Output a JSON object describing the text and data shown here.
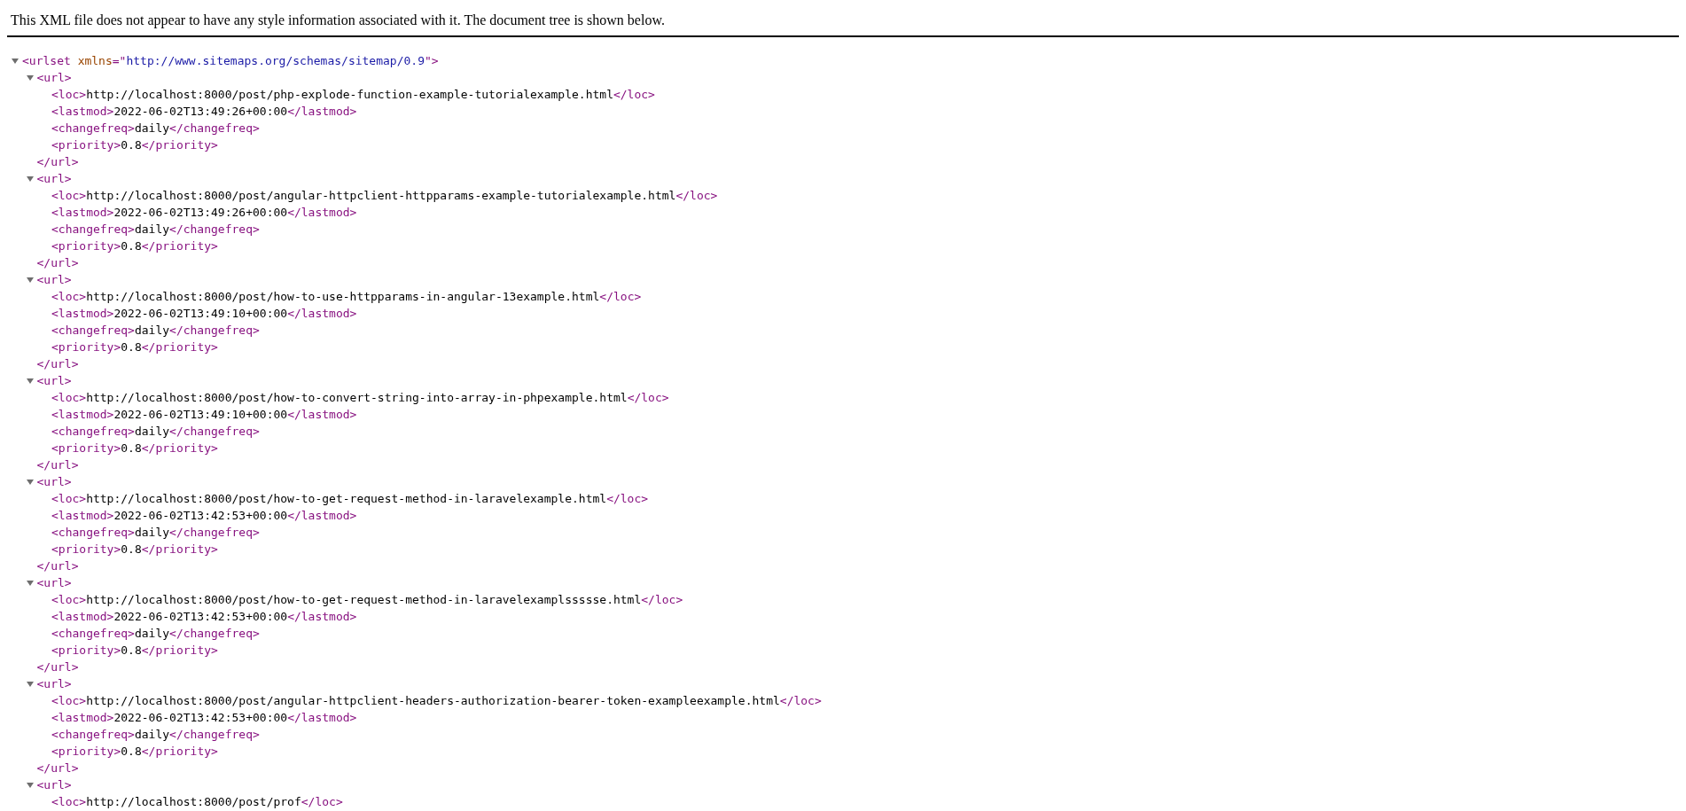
{
  "header": {
    "message": "This XML file does not appear to have any style information associated with it. The document tree is shown below."
  },
  "tree": {
    "expanded": true,
    "line": [
      {
        "kind": "tag",
        "text": "<urlset "
      },
      {
        "kind": "attr",
        "text": "xmlns"
      },
      {
        "kind": "tag",
        "text": "=\""
      },
      {
        "kind": "value",
        "text": "http://www.sitemaps.org/schemas/sitemap/0.9"
      },
      {
        "kind": "tag",
        "text": "\">"
      }
    ],
    "children": [
      {
        "expanded": true,
        "line": [
          {
            "kind": "tag",
            "text": "<url>"
          }
        ],
        "children": [
          {
            "line": [
              {
                "kind": "tag",
                "text": "<loc>"
              },
              {
                "kind": "text",
                "text": "http://localhost:8000/post/php-explode-function-example-tutorialexample.html"
              },
              {
                "kind": "tag",
                "text": "</loc>"
              }
            ]
          },
          {
            "line": [
              {
                "kind": "tag",
                "text": "<lastmod>"
              },
              {
                "kind": "text",
                "text": "2022-06-02T13:49:26+00:00"
              },
              {
                "kind": "tag",
                "text": "</lastmod>"
              }
            ]
          },
          {
            "line": [
              {
                "kind": "tag",
                "text": "<changefreq>"
              },
              {
                "kind": "text",
                "text": "daily"
              },
              {
                "kind": "tag",
                "text": "</changefreq>"
              }
            ]
          },
          {
            "line": [
              {
                "kind": "tag",
                "text": "<priority>"
              },
              {
                "kind": "text",
                "text": "0.8"
              },
              {
                "kind": "tag",
                "text": "</priority>"
              }
            ]
          }
        ],
        "close": [
          {
            "kind": "tag",
            "text": "</url>"
          }
        ]
      },
      {
        "expanded": true,
        "line": [
          {
            "kind": "tag",
            "text": "<url>"
          }
        ],
        "children": [
          {
            "line": [
              {
                "kind": "tag",
                "text": "<loc>"
              },
              {
                "kind": "text",
                "text": "http://localhost:8000/post/angular-httpclient-httpparams-example-tutorialexample.html"
              },
              {
                "kind": "tag",
                "text": "</loc>"
              }
            ]
          },
          {
            "line": [
              {
                "kind": "tag",
                "text": "<lastmod>"
              },
              {
                "kind": "text",
                "text": "2022-06-02T13:49:26+00:00"
              },
              {
                "kind": "tag",
                "text": "</lastmod>"
              }
            ]
          },
          {
            "line": [
              {
                "kind": "tag",
                "text": "<changefreq>"
              },
              {
                "kind": "text",
                "text": "daily"
              },
              {
                "kind": "tag",
                "text": "</changefreq>"
              }
            ]
          },
          {
            "line": [
              {
                "kind": "tag",
                "text": "<priority>"
              },
              {
                "kind": "text",
                "text": "0.8"
              },
              {
                "kind": "tag",
                "text": "</priority>"
              }
            ]
          }
        ],
        "close": [
          {
            "kind": "tag",
            "text": "</url>"
          }
        ]
      },
      {
        "expanded": true,
        "line": [
          {
            "kind": "tag",
            "text": "<url>"
          }
        ],
        "children": [
          {
            "line": [
              {
                "kind": "tag",
                "text": "<loc>"
              },
              {
                "kind": "text",
                "text": "http://localhost:8000/post/how-to-use-httpparams-in-angular-13example.html"
              },
              {
                "kind": "tag",
                "text": "</loc>"
              }
            ]
          },
          {
            "line": [
              {
                "kind": "tag",
                "text": "<lastmod>"
              },
              {
                "kind": "text",
                "text": "2022-06-02T13:49:10+00:00"
              },
              {
                "kind": "tag",
                "text": "</lastmod>"
              }
            ]
          },
          {
            "line": [
              {
                "kind": "tag",
                "text": "<changefreq>"
              },
              {
                "kind": "text",
                "text": "daily"
              },
              {
                "kind": "tag",
                "text": "</changefreq>"
              }
            ]
          },
          {
            "line": [
              {
                "kind": "tag",
                "text": "<priority>"
              },
              {
                "kind": "text",
                "text": "0.8"
              },
              {
                "kind": "tag",
                "text": "</priority>"
              }
            ]
          }
        ],
        "close": [
          {
            "kind": "tag",
            "text": "</url>"
          }
        ]
      },
      {
        "expanded": true,
        "line": [
          {
            "kind": "tag",
            "text": "<url>"
          }
        ],
        "children": [
          {
            "line": [
              {
                "kind": "tag",
                "text": "<loc>"
              },
              {
                "kind": "text",
                "text": "http://localhost:8000/post/how-to-convert-string-into-array-in-phpexample.html"
              },
              {
                "kind": "tag",
                "text": "</loc>"
              }
            ]
          },
          {
            "line": [
              {
                "kind": "tag",
                "text": "<lastmod>"
              },
              {
                "kind": "text",
                "text": "2022-06-02T13:49:10+00:00"
              },
              {
                "kind": "tag",
                "text": "</lastmod>"
              }
            ]
          },
          {
            "line": [
              {
                "kind": "tag",
                "text": "<changefreq>"
              },
              {
                "kind": "text",
                "text": "daily"
              },
              {
                "kind": "tag",
                "text": "</changefreq>"
              }
            ]
          },
          {
            "line": [
              {
                "kind": "tag",
                "text": "<priority>"
              },
              {
                "kind": "text",
                "text": "0.8"
              },
              {
                "kind": "tag",
                "text": "</priority>"
              }
            ]
          }
        ],
        "close": [
          {
            "kind": "tag",
            "text": "</url>"
          }
        ]
      },
      {
        "expanded": true,
        "line": [
          {
            "kind": "tag",
            "text": "<url>"
          }
        ],
        "children": [
          {
            "line": [
              {
                "kind": "tag",
                "text": "<loc>"
              },
              {
                "kind": "text",
                "text": "http://localhost:8000/post/how-to-get-request-method-in-laravelexample.html"
              },
              {
                "kind": "tag",
                "text": "</loc>"
              }
            ]
          },
          {
            "line": [
              {
                "kind": "tag",
                "text": "<lastmod>"
              },
              {
                "kind": "text",
                "text": "2022-06-02T13:42:53+00:00"
              },
              {
                "kind": "tag",
                "text": "</lastmod>"
              }
            ]
          },
          {
            "line": [
              {
                "kind": "tag",
                "text": "<changefreq>"
              },
              {
                "kind": "text",
                "text": "daily"
              },
              {
                "kind": "tag",
                "text": "</changefreq>"
              }
            ]
          },
          {
            "line": [
              {
                "kind": "tag",
                "text": "<priority>"
              },
              {
                "kind": "text",
                "text": "0.8"
              },
              {
                "kind": "tag",
                "text": "</priority>"
              }
            ]
          }
        ],
        "close": [
          {
            "kind": "tag",
            "text": "</url>"
          }
        ]
      },
      {
        "expanded": true,
        "line": [
          {
            "kind": "tag",
            "text": "<url>"
          }
        ],
        "children": [
          {
            "line": [
              {
                "kind": "tag",
                "text": "<loc>"
              },
              {
                "kind": "text",
                "text": "http://localhost:8000/post/how-to-get-request-method-in-laravelexamplssssse.html"
              },
              {
                "kind": "tag",
                "text": "</loc>"
              }
            ]
          },
          {
            "line": [
              {
                "kind": "tag",
                "text": "<lastmod>"
              },
              {
                "kind": "text",
                "text": "2022-06-02T13:42:53+00:00"
              },
              {
                "kind": "tag",
                "text": "</lastmod>"
              }
            ]
          },
          {
            "line": [
              {
                "kind": "tag",
                "text": "<changefreq>"
              },
              {
                "kind": "text",
                "text": "daily"
              },
              {
                "kind": "tag",
                "text": "</changefreq>"
              }
            ]
          },
          {
            "line": [
              {
                "kind": "tag",
                "text": "<priority>"
              },
              {
                "kind": "text",
                "text": "0.8"
              },
              {
                "kind": "tag",
                "text": "</priority>"
              }
            ]
          }
        ],
        "close": [
          {
            "kind": "tag",
            "text": "</url>"
          }
        ]
      },
      {
        "expanded": true,
        "line": [
          {
            "kind": "tag",
            "text": "<url>"
          }
        ],
        "children": [
          {
            "line": [
              {
                "kind": "tag",
                "text": "<loc>"
              },
              {
                "kind": "text",
                "text": "http://localhost:8000/post/angular-httpclient-headers-authorization-bearer-token-exampleexample.html"
              },
              {
                "kind": "tag",
                "text": "</loc>"
              }
            ]
          },
          {
            "line": [
              {
                "kind": "tag",
                "text": "<lastmod>"
              },
              {
                "kind": "text",
                "text": "2022-06-02T13:42:53+00:00"
              },
              {
                "kind": "tag",
                "text": "</lastmod>"
              }
            ]
          },
          {
            "line": [
              {
                "kind": "tag",
                "text": "<changefreq>"
              },
              {
                "kind": "text",
                "text": "daily"
              },
              {
                "kind": "tag",
                "text": "</changefreq>"
              }
            ]
          },
          {
            "line": [
              {
                "kind": "tag",
                "text": "<priority>"
              },
              {
                "kind": "text",
                "text": "0.8"
              },
              {
                "kind": "tag",
                "text": "</priority>"
              }
            ]
          }
        ],
        "close": [
          {
            "kind": "tag",
            "text": "</url>"
          }
        ]
      },
      {
        "expanded": true,
        "line": [
          {
            "kind": "tag",
            "text": "<url>"
          }
        ],
        "children": [
          {
            "line": [
              {
                "kind": "tag",
                "text": "<loc>"
              },
              {
                "kind": "text",
                "text": "http://localhost:8000/post/prof"
              },
              {
                "kind": "tag",
                "text": "</loc>"
              }
            ]
          }
        ]
      }
    ]
  }
}
